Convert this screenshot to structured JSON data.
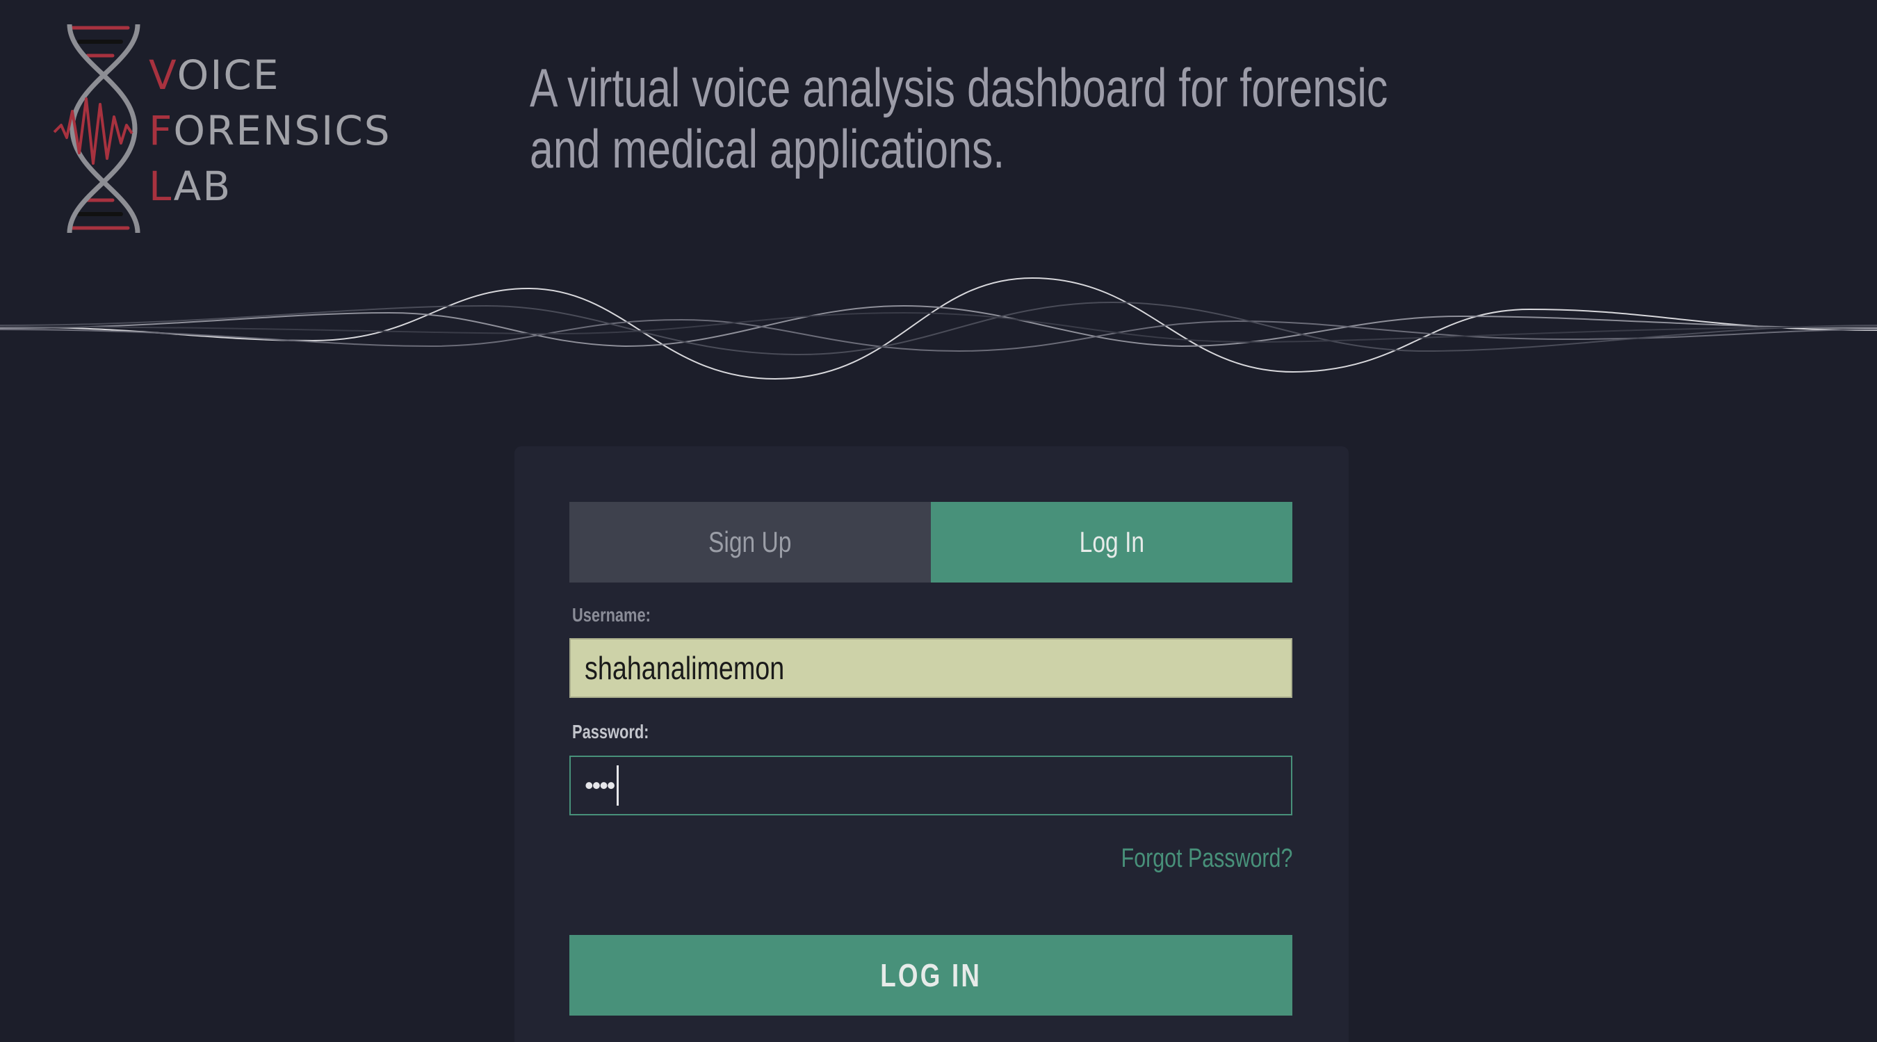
{
  "brand": {
    "logo_lines": [
      {
        "accent": "V",
        "rest": "OICE"
      },
      {
        "accent": "F",
        "rest": "ORENSICS"
      },
      {
        "accent": "L",
        "rest": "AB"
      }
    ],
    "accent_color": "#a8323f",
    "text_color": "#a1a2a8",
    "icon": "dna-helix-waveform-icon"
  },
  "tagline": {
    "line1": "A virtual voice analysis dashboard for forensic",
    "line2": "and medical applications."
  },
  "auth": {
    "tabs": [
      {
        "label": "Sign Up",
        "active": false
      },
      {
        "label": "Log In",
        "active": true
      }
    ],
    "username": {
      "label": "Username:",
      "value": "shahanalimemon"
    },
    "password": {
      "label": "Password:",
      "masked_value": "••••"
    },
    "forgot_link": "Forgot Password?",
    "submit_label": "LOG IN"
  },
  "colors": {
    "background": "#1c1e2a",
    "card": "#222432",
    "accent_green": "#48917a",
    "inactive_tab": "#3e414d",
    "autofill_field": "#cdd2a8"
  }
}
